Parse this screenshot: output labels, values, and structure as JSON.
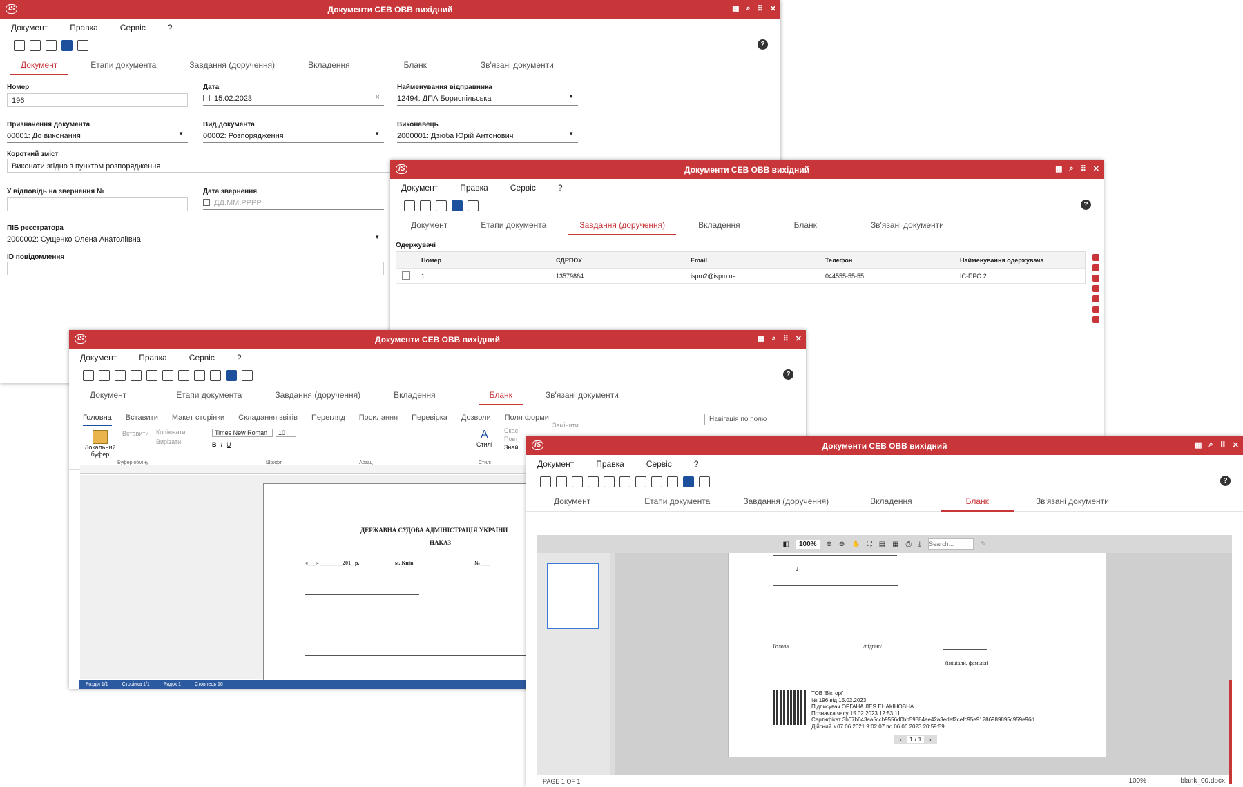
{
  "window_title": "Документи СЕВ ОВВ вихідний",
  "logo": "iS",
  "logo_sub": "pro",
  "menu": [
    "Документ",
    "Правка",
    "Сервіс",
    "?"
  ],
  "help": "?",
  "tabs": [
    "Документ",
    "Етапи документа",
    "Завдання (доручення)",
    "Вкладення",
    "Бланк",
    "Зв'язані документи"
  ],
  "w1": {
    "labels": {
      "number": "Номер",
      "date": "Дата",
      "sender": "Найменування відправника",
      "purpose": "Призначення документа",
      "kind": "Вид документа",
      "executor": "Виконавець",
      "summary": "Короткий зміст",
      "reply": "У відповідь на звернення №",
      "appeal_date": "Дата звернення",
      "registrar": "ПІБ реєстратора",
      "msg_id": "ID повідомлення"
    },
    "values": {
      "number": "196",
      "date": "15.02.2023",
      "sender": "12494: ДПА Бориспільська",
      "purpose": "00001: До виконання",
      "kind": "00002: Розпорядження",
      "executor": "2000001: Дзюба Юрій Антонович",
      "summary": "Виконати згідно з пунктом розпорядження",
      "appeal_date_ph": "ДД.ММ.РРРР",
      "registrar": "2000002: Сущенко Олена Анатоліївна"
    }
  },
  "w2": {
    "section": "Одержувачі",
    "columns": [
      "Номер",
      "ЄДРПОУ",
      "Email",
      "Телефон",
      "Найменування одержувача"
    ],
    "rows": [
      [
        "1",
        "13579864",
        "ispro2@ispro.ua",
        "044555-55-55",
        "ІС-ПРО 2"
      ]
    ]
  },
  "w3": {
    "ribbon_tabs": [
      "Головна",
      "Вставити",
      "Макет сторінки",
      "Складання звітів",
      "Перегляд",
      "Посилання",
      "Перевірка",
      "Дозволи",
      "Поля форми"
    ],
    "nav_button": "Навігація по полю",
    "local_buffer": "Локальний буфер",
    "paste": "Вставити",
    "copy": "Копіювати",
    "cut": "Вирізати",
    "group_buffer": "Буфер обміну",
    "font_name": "Times New Roman",
    "font_size": "10",
    "group_font": "Шрифт",
    "group_para": "Абзац",
    "styles": "Стилі",
    "group_styles": "Стилі",
    "undo": "Скас",
    "redo": "Повт",
    "find": "Знай",
    "replace": "Замінити",
    "doc_title": "ДЕРЖАВНА СУДОВА АДМІНІСТРАЦІЯ УКРАЇНИ",
    "doc_subtitle": "НАКАЗ",
    "doc_line": "«___» ________201_ р.",
    "doc_city": "м. Київ",
    "doc_num": "№ ___",
    "status": [
      "Розділ 1/1",
      "Сторінка 1/1",
      "Рядок 1",
      "Стовпець 16"
    ]
  },
  "w4": {
    "zoom": "100%",
    "search_ph": "Search...",
    "page_nav": "1 / 1",
    "item_num": "2",
    "head": "Голова",
    "sign": "/підпис/",
    "initials": "(ініціали, фамілія)",
    "sig_lines": [
      "ТОВ 'Вікторі'",
      "№ 196 від 15.02.2023",
      "Підписувач ОРГАНА ЛЕЯ ЕНАКІНОВНА",
      "Позначка часу 15.02.2023 12:53:11",
      "Сертифікат 3b07b643aa5ccb9556d0bb59384ee42a3edef2cefc95e91286989895c959e96d",
      "Дійсний з 07.06.2021 9:02:07 по 06.06.2023 20:59:59"
    ],
    "footer_page": "PAGE 1 OF 1",
    "footer_zoom": "100%",
    "footer_file": "blank_00.docx"
  }
}
